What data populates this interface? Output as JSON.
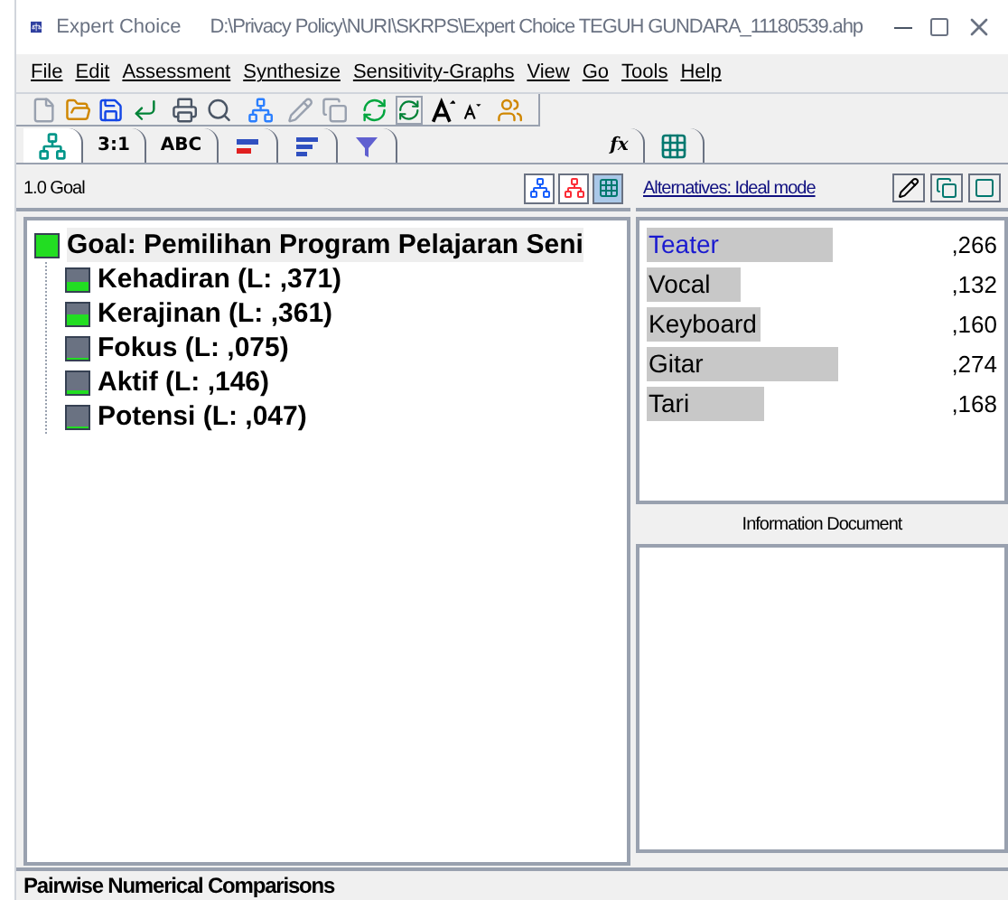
{
  "window": {
    "app_name": "Expert Choice",
    "path": "D:\\Privacy Policy\\NURI\\SKRPS\\Expert Choice TEGUH GUNDARA_11180539.ahp"
  },
  "menu": [
    "File",
    "Edit",
    "Assessment",
    "Synthesize",
    "Sensitivity-Graphs",
    "View",
    "Go",
    "Tools",
    "Help"
  ],
  "tabs": [
    {
      "kind": "icon",
      "selected": true
    },
    {
      "kind": "text",
      "label": "3:1",
      "selected": false
    },
    {
      "kind": "text",
      "label": "ABC",
      "selected": false
    },
    {
      "kind": "icon",
      "selected": false
    },
    {
      "kind": "icon",
      "selected": false
    },
    {
      "kind": "icon",
      "selected": false
    },
    {
      "kind": "text",
      "label": "fx",
      "selected": false
    },
    {
      "kind": "icon",
      "selected": false
    }
  ],
  "tree": {
    "header": "1.0 Goal",
    "root": {
      "label": "Goal: Pemilihan Program Pelajaran Seni",
      "children": [
        {
          "label": "Kehadiran (L: ,371)"
        },
        {
          "label": "Kerajinan (L: ,361)"
        },
        {
          "label": "Fokus (L: ,075)"
        },
        {
          "label": "Aktif (L: ,146)"
        },
        {
          "label": "Potensi (L: ,047)"
        }
      ]
    }
  },
  "alternatives": {
    "header": "Alternatives: Ideal mode",
    "items": [
      {
        "name": "Teater",
        "value": ",266",
        "selected": true
      },
      {
        "name": "Vocal",
        "value": ",132",
        "selected": false
      },
      {
        "name": "Keyboard",
        "value": ",160",
        "selected": false
      },
      {
        "name": "Gitar",
        "value": ",274",
        "selected": false
      },
      {
        "name": "Tari",
        "value": ",168",
        "selected": false
      }
    ]
  },
  "info_document": {
    "title": "Information Document"
  },
  "status_bar": "Pairwise Numerical Comparisons"
}
